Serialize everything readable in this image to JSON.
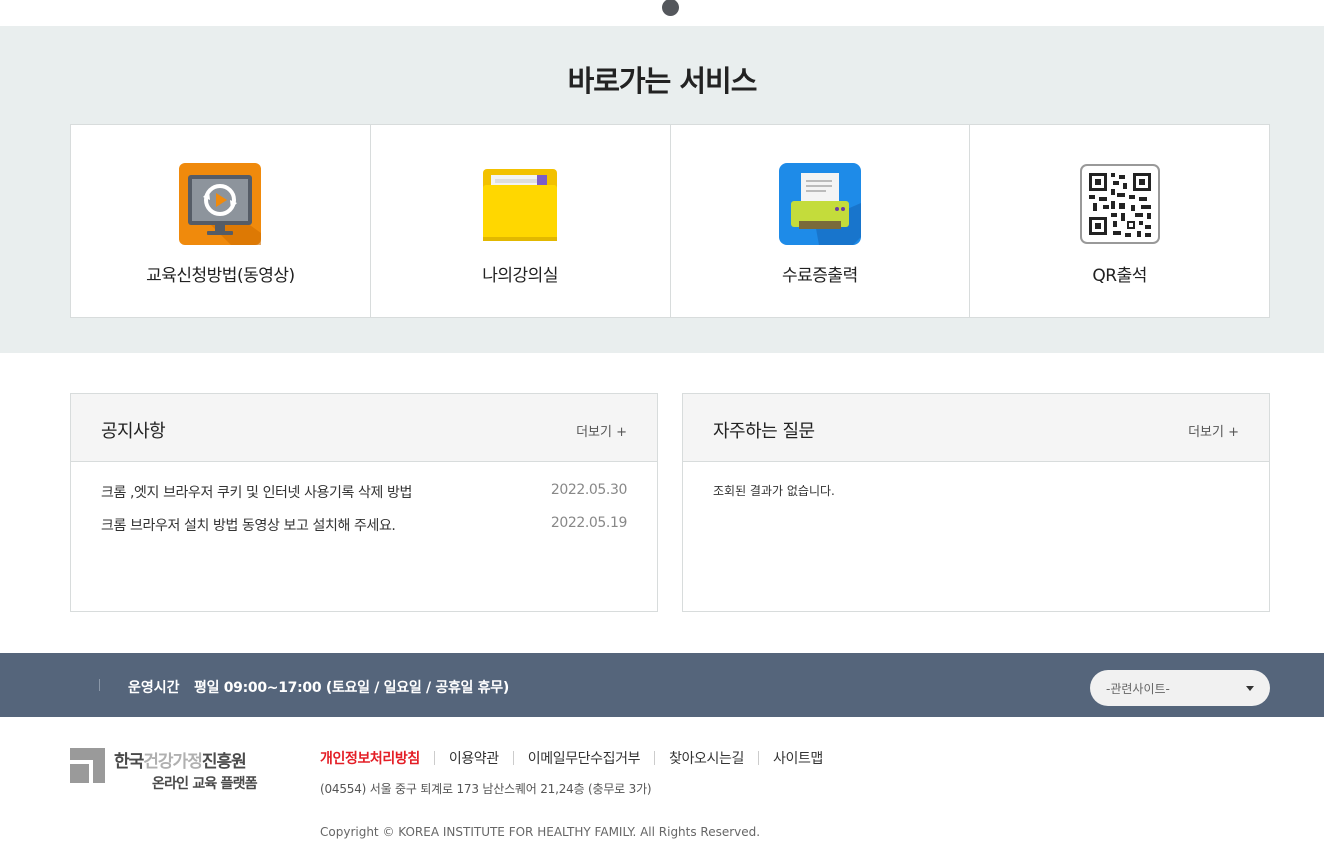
{
  "quick": {
    "title": "바로가는 서비스",
    "items": [
      {
        "label": "교육신청방법(동영상)",
        "icon": "video-monitor-icon"
      },
      {
        "label": "나의강의실",
        "icon": "folder-icon"
      },
      {
        "label": "수료증출력",
        "icon": "printer-icon"
      },
      {
        "label": "QR출석",
        "icon": "qr-code-icon"
      }
    ]
  },
  "notice": {
    "title": "공지사항",
    "more": "더보기 +",
    "rows": [
      {
        "title": "크롬 ,엣지 브라우저 쿠키 및 인터넷 사용기록 삭제 방법",
        "date": "2022.05.30"
      },
      {
        "title": "크롬 브라우저 설치 방법 동영상 보고 설치해 주세요.",
        "date": "2022.05.19"
      }
    ]
  },
  "faq": {
    "title": "자주하는 질문",
    "more": "더보기 +",
    "empty": "조회된 결과가 없습니다."
  },
  "footer": {
    "hours_label": "운영시간",
    "hours_value": "평일 09:00~17:00 (토요일 / 일요일 / 공휴일 휴무)",
    "related_select": "-관련사이트-",
    "logo_name_a": "한국",
    "logo_name_b": "건강가정",
    "logo_name_c": "진흥원",
    "logo_sub": "온라인 교육 플랫폼",
    "links": [
      "개인정보처리방침",
      "이용약관",
      "이메일무단수집거부",
      "찾아오시는길",
      "사이트맵"
    ],
    "address": "(04554) 서울 중구 퇴계로 173 남산스퀘어 21,24층 (충무로 3가)",
    "copyright": "Copyright © KOREA INSTITUTE FOR HEALTHY FAMILY. All Rights Reserved."
  },
  "colors": {
    "footer_bar": "#55657b",
    "quick_bg": "#e9eeee",
    "link_accent": "#e41e26"
  }
}
